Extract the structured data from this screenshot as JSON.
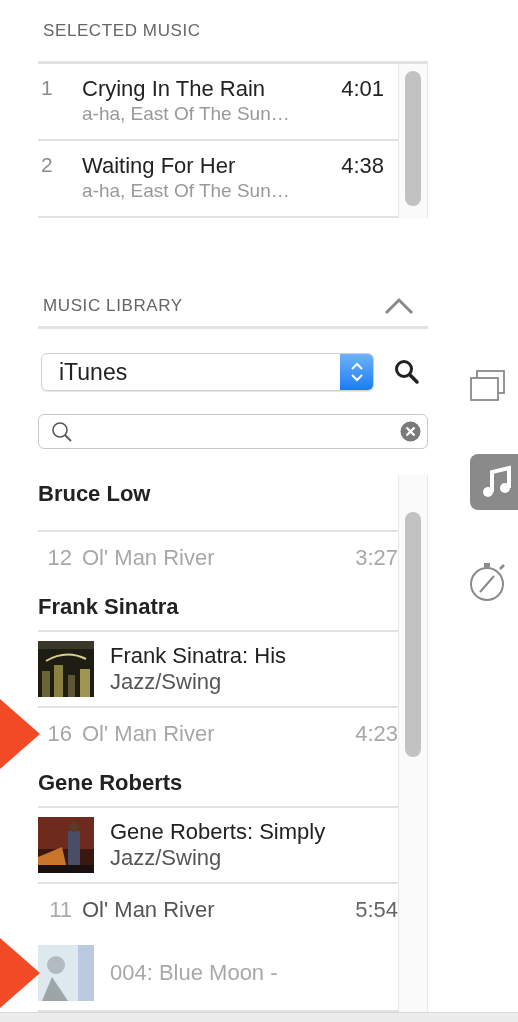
{
  "selected_music": {
    "title": "SELECTED MUSIC",
    "tracks": [
      {
        "number": "1",
        "title": "Crying In The Rain",
        "subtitle": "a-ha, East Of The Sun…",
        "time": "4:01"
      },
      {
        "number": "2",
        "title": "Waiting For Her",
        "subtitle": "a-ha, East Of The Sun…",
        "time": "4:38"
      }
    ]
  },
  "music_library": {
    "title": "MUSIC LIBRARY",
    "expanded": true,
    "source": "iTunes",
    "items": [
      {
        "kind": "artist",
        "name": "Bruce Low"
      },
      {
        "kind": "track",
        "number": "12",
        "title": "Ol' Man River",
        "time": "3:27",
        "disabled": true,
        "pointer": false
      },
      {
        "kind": "artist",
        "name": "Frank Sinatra"
      },
      {
        "kind": "album",
        "title": "Frank Sinatra: His",
        "genre": "Jazz/Swing",
        "disabled": false,
        "pointer": false
      },
      {
        "kind": "track",
        "number": "16",
        "title": "Ol' Man River",
        "time": "4:23",
        "disabled": true,
        "pointer": true
      },
      {
        "kind": "artist",
        "name": "Gene Roberts"
      },
      {
        "kind": "album",
        "title": "Gene Roberts: Simply",
        "genre": "Jazz/Swing",
        "disabled": false,
        "pointer": false
      },
      {
        "kind": "track",
        "number": "11",
        "title": "Ol' Man River",
        "time": "5:54",
        "disabled": false,
        "pointer": false
      },
      {
        "kind": "album",
        "title": "004: Blue Moon -",
        "disabled": true,
        "pointer": true
      }
    ]
  },
  "side_tabs": [
    {
      "kind": "windows",
      "selected": false
    },
    {
      "kind": "music",
      "selected": true
    },
    {
      "kind": "timer",
      "selected": false
    }
  ]
}
